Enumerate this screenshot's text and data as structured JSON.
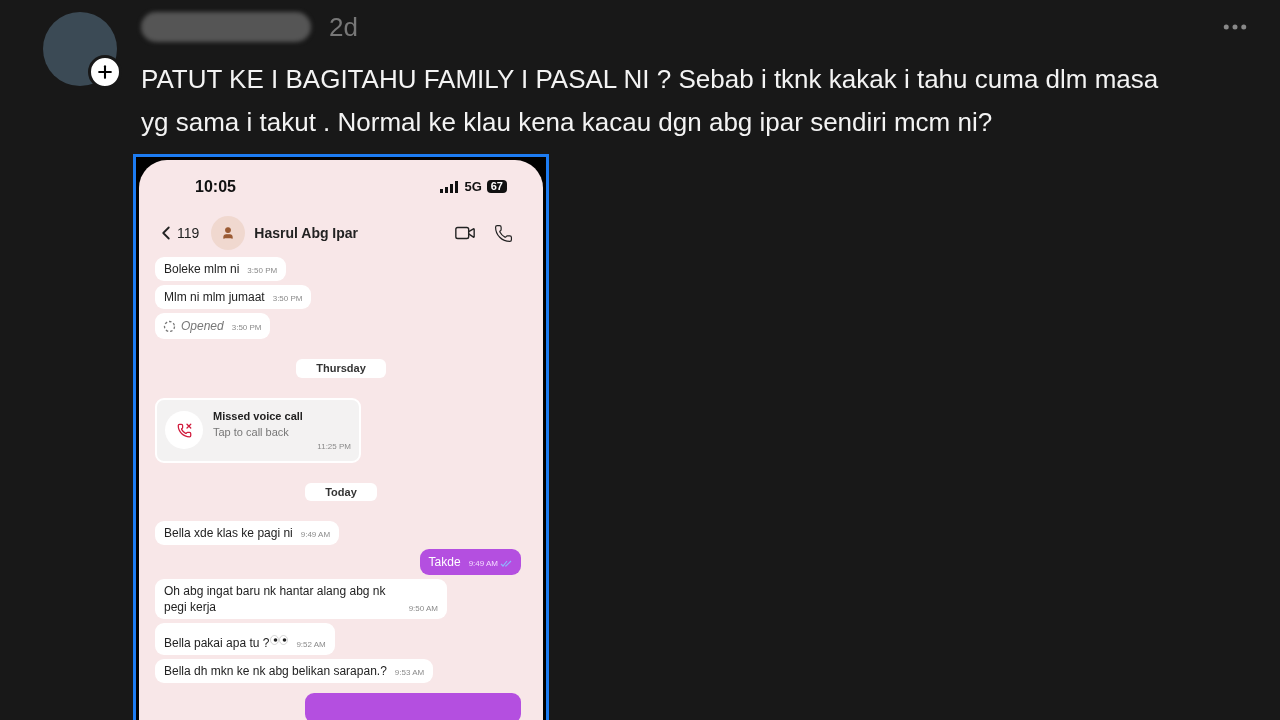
{
  "post": {
    "time": "2d",
    "text": "PATUT KE I BAGITAHU FAMILY I PASAL NI ? Sebab i tknk kakak i tahu cuma dlm masa yg sama i takut . Normal ke klau kena kacau dgn abg ipar sendiri mcm ni?"
  },
  "phone": {
    "status_time": "10:05",
    "network": "5G",
    "battery": "67"
  },
  "chat": {
    "back_count": "119",
    "contact": "Hasrul Abg Ipar"
  },
  "messages": [
    {
      "kind": "incoming",
      "text": "Boleke mlm ni",
      "time": "3:50 PM"
    },
    {
      "kind": "incoming",
      "text": "Mlm ni mlm jumaat",
      "time": "3:50 PM"
    },
    {
      "kind": "opened",
      "text": "Opened",
      "time": "3:50 PM"
    },
    {
      "kind": "date",
      "text": "Thursday"
    },
    {
      "kind": "missed_call",
      "text": "Missed voice call",
      "subtext": "Tap to call back",
      "time": "11:25 PM"
    },
    {
      "kind": "date",
      "text": "Today"
    },
    {
      "kind": "incoming",
      "text": "Bella xde klas ke pagi ni",
      "time": "9:49 AM"
    },
    {
      "kind": "outgoing",
      "text": "Takde",
      "time": "9:49 AM",
      "read": true
    },
    {
      "kind": "incoming",
      "text": "Oh abg ingat baru nk hantar alang abg nk pegi kerja",
      "time": "9:50 AM"
    },
    {
      "kind": "incoming",
      "text": "Bella pakai apa tu ?",
      "time": "9:52 AM",
      "eyes_emoji": true
    },
    {
      "kind": "incoming",
      "text": "Bella dh mkn ke nk abg belikan sarapan.?",
      "time": "9:53 AM"
    },
    {
      "kind": "outgoing_cut"
    }
  ]
}
